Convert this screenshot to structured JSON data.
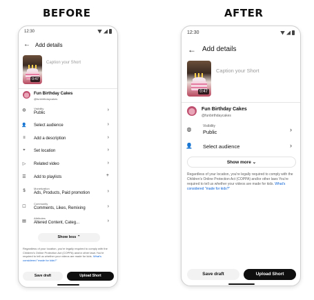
{
  "labels": {
    "before": "BEFORE",
    "after": "AFTER"
  },
  "status": {
    "time": "12:30"
  },
  "header": {
    "title": "Add details"
  },
  "video": {
    "caption_placeholder": "Caption your Short",
    "duration": "0:47"
  },
  "channel": {
    "name": "Fun Birthday Cakes",
    "handle": "@funbirthdaycakes"
  },
  "before_rows": [
    {
      "sub": "Visibility",
      "label": "Public"
    },
    {
      "label": "Select audience"
    },
    {
      "label": "Add a description"
    },
    {
      "label": "Set location"
    },
    {
      "label": "Related video"
    },
    {
      "label": "Add to playlists"
    },
    {
      "sub": "Monetization",
      "label": "Ads, Products, Paid promotion"
    },
    {
      "sub": "Community",
      "label": "Comments, Likes, Remixing"
    },
    {
      "sub": "Attributes",
      "label": "Altered Content, Categ..."
    }
  ],
  "after_rows": [
    {
      "sub": "Visibility",
      "label": "Public"
    },
    {
      "label": "Select audience"
    }
  ],
  "show_less": "Show less",
  "show_more": "Show more",
  "notice": {
    "text": "Regardless of your location, you're legally required to comply with the Children's Online Protection Act (COPPA) and/or other laws You're required to tell us whether your videos are made for kids.",
    "link": "What's considered \"made for kids?\""
  },
  "buttons": {
    "save_draft": "Save draft",
    "upload": "Upload Short"
  }
}
